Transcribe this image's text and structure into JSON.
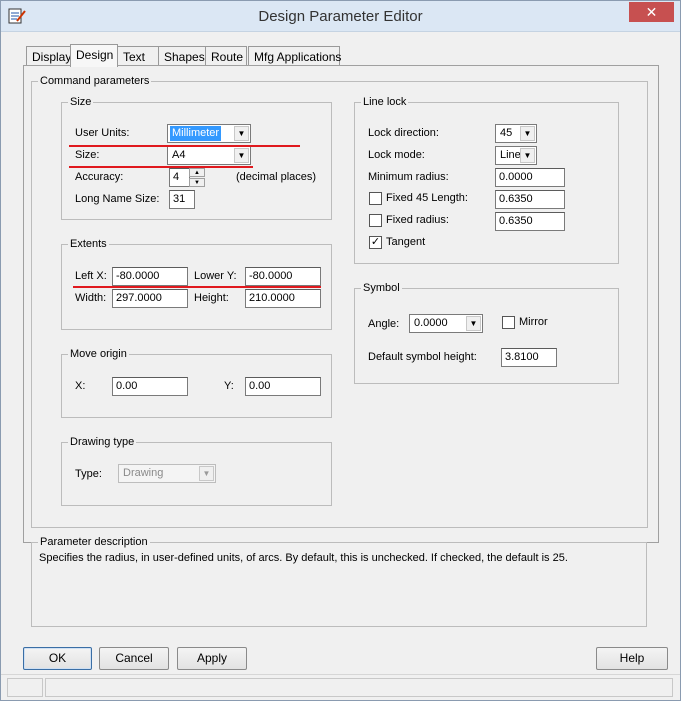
{
  "window": {
    "title": "Design Parameter Editor",
    "close_glyph": "✕",
    "app_icon": "editor-icon"
  },
  "tabs": [
    "Display",
    "Design",
    "Text",
    "Shapes",
    "Route",
    "Mfg Applications"
  ],
  "active_tab": "Design",
  "command_parameters": {
    "title": "Command parameters",
    "size_group": {
      "title": "Size",
      "user_units_label": "User Units:",
      "user_units_value": "Millimeter",
      "size_label": "Size:",
      "size_value": "A4",
      "accuracy_label": "Accuracy:",
      "accuracy_value": "4",
      "accuracy_suffix": "(decimal places)",
      "long_name_label": "Long Name Size:",
      "long_name_value": "31"
    },
    "extents_group": {
      "title": "Extents",
      "left_x_label": "Left X:",
      "left_x_value": "-80.0000",
      "lower_y_label": "Lower Y:",
      "lower_y_value": "-80.0000",
      "width_label": "Width:",
      "width_value": "297.0000",
      "height_label": "Height:",
      "height_value": "210.0000"
    },
    "move_origin_group": {
      "title": "Move origin",
      "x_label": "X:",
      "x_value": "0.00",
      "y_label": "Y:",
      "y_value": "0.00"
    },
    "drawing_type_group": {
      "title": "Drawing type",
      "type_label": "Type:",
      "type_value": "Drawing"
    },
    "line_lock_group": {
      "title": "Line lock",
      "lock_direction_label": "Lock direction:",
      "lock_direction_value": "45",
      "lock_mode_label": "Lock mode:",
      "lock_mode_value": "Line",
      "min_radius_label": "Minimum radius:",
      "min_radius_value": "0.0000",
      "fixed45_label": "Fixed 45 Length:",
      "fixed45_value": "0.6350",
      "fixed45_checked": false,
      "fixed_radius_label": "Fixed radius:",
      "fixed_radius_value": "0.6350",
      "fixed_radius_checked": false,
      "tangent_label": "Tangent",
      "tangent_checked": true
    },
    "symbol_group": {
      "title": "Symbol",
      "angle_label": "Angle:",
      "angle_value": "0.0000",
      "mirror_label": "Mirror",
      "mirror_checked": false,
      "default_height_label": "Default symbol height:",
      "default_height_value": "3.8100"
    }
  },
  "parameter_description": {
    "title": "Parameter description",
    "text": "Specifies the radius, in user-defined units, of arcs. By default, this is unchecked. If checked, the default is 25."
  },
  "buttons": {
    "ok": "OK",
    "cancel": "Cancel",
    "apply": "Apply",
    "help": "Help"
  },
  "glyphs": {
    "dropdown": "▼",
    "spin_up": "▲",
    "spin_down": "▼",
    "check": "✓"
  },
  "colors": {
    "annotation_red": "#e0191e",
    "selection_blue": "#3399ff",
    "close_red": "#c75050"
  }
}
